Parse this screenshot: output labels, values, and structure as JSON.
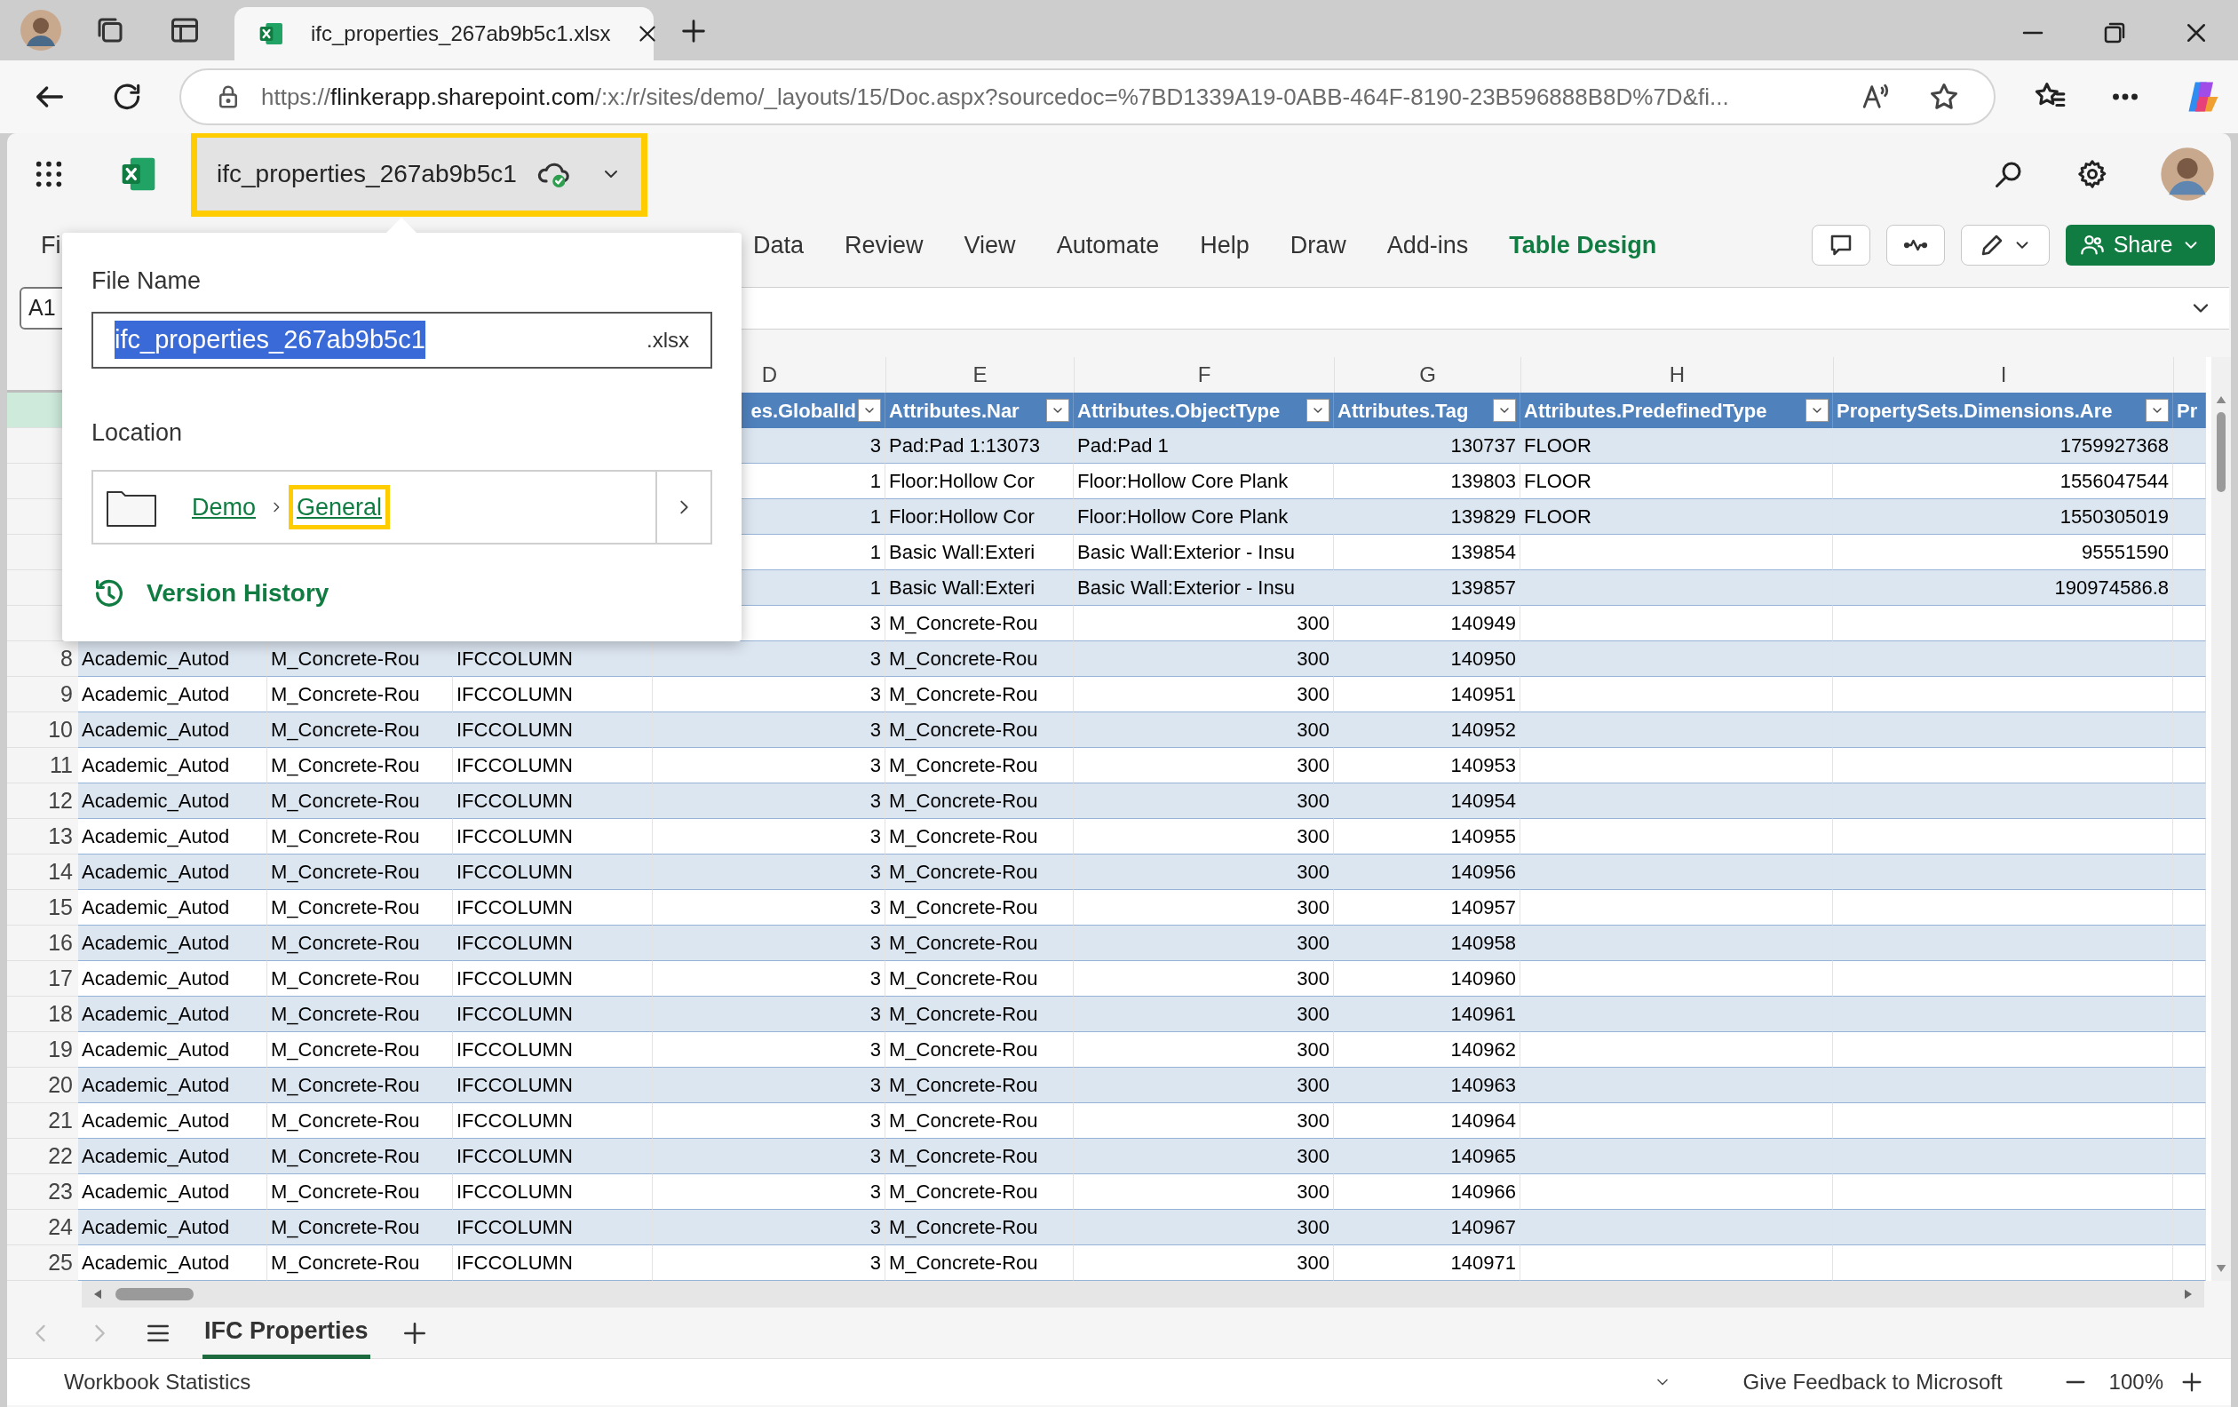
{
  "browser": {
    "tab_title": "ifc_properties_267ab9b5c1.xlsx",
    "url": {
      "scheme": "https://",
      "domain": "flinkerapp.sharepoint.com",
      "path": "/:x:/r/sites/demo/_layouts/15/Doc.aspx?sourcedoc=%7BD1339A19-0ABB-464F-8190-23B596888B8D%7D&fi..."
    }
  },
  "app": {
    "file_name": "ifc_properties_267ab9b5c1",
    "file_highlighted": true,
    "ribbon_tabs": [
      {
        "label": "Fi",
        "selected": false
      },
      {
        "label": "Data",
        "selected": false
      },
      {
        "label": "Review",
        "selected": false
      },
      {
        "label": "View",
        "selected": false
      },
      {
        "label": "Automate",
        "selected": false
      },
      {
        "label": "Help",
        "selected": false
      },
      {
        "label": "Draw",
        "selected": false
      },
      {
        "label": "Add-ins",
        "selected": false
      },
      {
        "label": "Table Design",
        "selected": true
      }
    ],
    "share_label": "Share",
    "name_box": "A1"
  },
  "popup": {
    "file_name_label": "File Name",
    "file_name_value": "ifc_properties_267ab9b5c1",
    "extension": ".xlsx",
    "location_label": "Location",
    "breadcrumbs": [
      {
        "label": "Demo",
        "highlighted": false
      },
      {
        "label": "General",
        "highlighted": true
      }
    ],
    "version_history": "Version History"
  },
  "sheet": {
    "column_letters": [
      "D",
      "E",
      "F",
      "G",
      "H",
      "I"
    ],
    "rows": [
      {
        "kind": "header",
        "selected": true,
        "cells": [
          null,
          null,
          null,
          "es.GlobalId",
          "Attributes.Nar",
          "Attributes.ObjectType",
          "Attributes.Tag",
          "Attributes.PredefinedType",
          "PropertySets.Dimensions.Are",
          "Pr"
        ]
      },
      {
        "kind": "element",
        "selected": false,
        "cells": [
          null,
          null,
          null,
          "3",
          "Pad:Pad 1:13073",
          "Pad:Pad 1",
          "130737",
          "FLOOR",
          "1759927368",
          null
        ]
      },
      {
        "kind": "element",
        "selected": false,
        "cells": [
          null,
          null,
          null,
          "1",
          "Floor:Hollow Cor",
          "Floor:Hollow Core Plank",
          "139803",
          "FLOOR",
          "1556047544",
          null
        ]
      },
      {
        "kind": "element",
        "selected": false,
        "cells": [
          null,
          null,
          null,
          "1",
          "Floor:Hollow Cor",
          "Floor:Hollow Core Plank",
          "139829",
          "FLOOR",
          "1550305019",
          null
        ]
      },
      {
        "kind": "element",
        "selected": false,
        "cells": [
          null,
          null,
          null,
          "1",
          "Basic Wall:Exteri",
          "Basic Wall:Exterior - Insu",
          "139854",
          null,
          "95551590",
          null
        ]
      },
      {
        "kind": "element",
        "selected": false,
        "cells": [
          null,
          null,
          null,
          "1",
          "Basic Wall:Exteri",
          "Basic Wall:Exterior - Insu",
          "139857",
          null,
          "190974586.8",
          null
        ]
      },
      {
        "kind": "column",
        "selected": false,
        "cells": [
          null,
          null,
          null,
          "3",
          "M_Concrete-Rou",
          "300",
          "140949",
          null,
          null,
          null
        ]
      },
      {
        "kind": "column",
        "selected": false,
        "number": "8",
        "cells": [
          "Academic_Autod",
          "M_Concrete-Rou",
          "IFCCOLUMN",
          "3",
          "M_Concrete-Rou",
          "300",
          "140950",
          null,
          null,
          null
        ]
      },
      {
        "kind": "column",
        "selected": false,
        "number": "9",
        "cells": [
          "Academic_Autod",
          "M_Concrete-Rou",
          "IFCCOLUMN",
          "3",
          "M_Concrete-Rou",
          "300",
          "140951",
          null,
          null,
          null
        ]
      },
      {
        "kind": "column",
        "selected": false,
        "number": "10",
        "cells": [
          "Academic_Autod",
          "M_Concrete-Rou",
          "IFCCOLUMN",
          "3",
          "M_Concrete-Rou",
          "300",
          "140952",
          null,
          null,
          null
        ]
      },
      {
        "kind": "column",
        "selected": false,
        "number": "11",
        "cells": [
          "Academic_Autod",
          "M_Concrete-Rou",
          "IFCCOLUMN",
          "3",
          "M_Concrete-Rou",
          "300",
          "140953",
          null,
          null,
          null
        ]
      },
      {
        "kind": "column",
        "selected": false,
        "number": "12",
        "cells": [
          "Academic_Autod",
          "M_Concrete-Rou",
          "IFCCOLUMN",
          "3",
          "M_Concrete-Rou",
          "300",
          "140954",
          null,
          null,
          null
        ]
      },
      {
        "kind": "column",
        "selected": false,
        "number": "13",
        "cells": [
          "Academic_Autod",
          "M_Concrete-Rou",
          "IFCCOLUMN",
          "3",
          "M_Concrete-Rou",
          "300",
          "140955",
          null,
          null,
          null
        ]
      },
      {
        "kind": "column",
        "selected": false,
        "number": "14",
        "cells": [
          "Academic_Autod",
          "M_Concrete-Rou",
          "IFCCOLUMN",
          "3",
          "M_Concrete-Rou",
          "300",
          "140956",
          null,
          null,
          null
        ]
      },
      {
        "kind": "column",
        "selected": false,
        "number": "15",
        "cells": [
          "Academic_Autod",
          "M_Concrete-Rou",
          "IFCCOLUMN",
          "3",
          "M_Concrete-Rou",
          "300",
          "140957",
          null,
          null,
          null
        ]
      },
      {
        "kind": "column",
        "selected": false,
        "number": "16",
        "cells": [
          "Academic_Autod",
          "M_Concrete-Rou",
          "IFCCOLUMN",
          "3",
          "M_Concrete-Rou",
          "300",
          "140958",
          null,
          null,
          null
        ]
      },
      {
        "kind": "column",
        "selected": false,
        "number": "17",
        "cells": [
          "Academic_Autod",
          "M_Concrete-Rou",
          "IFCCOLUMN",
          "3",
          "M_Concrete-Rou",
          "300",
          "140960",
          null,
          null,
          null
        ]
      },
      {
        "kind": "column",
        "selected": false,
        "number": "18",
        "cells": [
          "Academic_Autod",
          "M_Concrete-Rou",
          "IFCCOLUMN",
          "3",
          "M_Concrete-Rou",
          "300",
          "140961",
          null,
          null,
          null
        ]
      },
      {
        "kind": "column",
        "selected": false,
        "number": "19",
        "cells": [
          "Academic_Autod",
          "M_Concrete-Rou",
          "IFCCOLUMN",
          "3",
          "M_Concrete-Rou",
          "300",
          "140962",
          null,
          null,
          null
        ]
      },
      {
        "kind": "column",
        "selected": false,
        "number": "20",
        "cells": [
          "Academic_Autod",
          "M_Concrete-Rou",
          "IFCCOLUMN",
          "3",
          "M_Concrete-Rou",
          "300",
          "140963",
          null,
          null,
          null
        ]
      },
      {
        "kind": "column",
        "selected": false,
        "number": "21",
        "cells": [
          "Academic_Autod",
          "M_Concrete-Rou",
          "IFCCOLUMN",
          "3",
          "M_Concrete-Rou",
          "300",
          "140964",
          null,
          null,
          null
        ]
      },
      {
        "kind": "column",
        "selected": false,
        "number": "22",
        "cells": [
          "Academic_Autod",
          "M_Concrete-Rou",
          "IFCCOLUMN",
          "3",
          "M_Concrete-Rou",
          "300",
          "140965",
          null,
          null,
          null
        ]
      },
      {
        "kind": "column",
        "selected": false,
        "number": "23",
        "cells": [
          "Academic_Autod",
          "M_Concrete-Rou",
          "IFCCOLUMN",
          "3",
          "M_Concrete-Rou",
          "300",
          "140966",
          null,
          null,
          null
        ]
      },
      {
        "kind": "column",
        "selected": false,
        "number": "24",
        "cells": [
          "Academic_Autod",
          "M_Concrete-Rou",
          "IFCCOLUMN",
          "3",
          "M_Concrete-Rou",
          "300",
          "140967",
          null,
          null,
          null
        ]
      },
      {
        "kind": "column",
        "selected": false,
        "number": "25",
        "cells": [
          "Academic_Autod",
          "M_Concrete-Rou",
          "IFCCOLUMN",
          "3",
          "M_Concrete-Rou",
          "300",
          "140971",
          null,
          null,
          null
        ]
      }
    ],
    "sheet_tabs": [
      {
        "label": "IFC Properties",
        "selected": true
      }
    ]
  },
  "status_bar": {
    "left": "Workbook Statistics",
    "feedback": "Give Feedback to Microsoft",
    "zoom": "100%"
  }
}
